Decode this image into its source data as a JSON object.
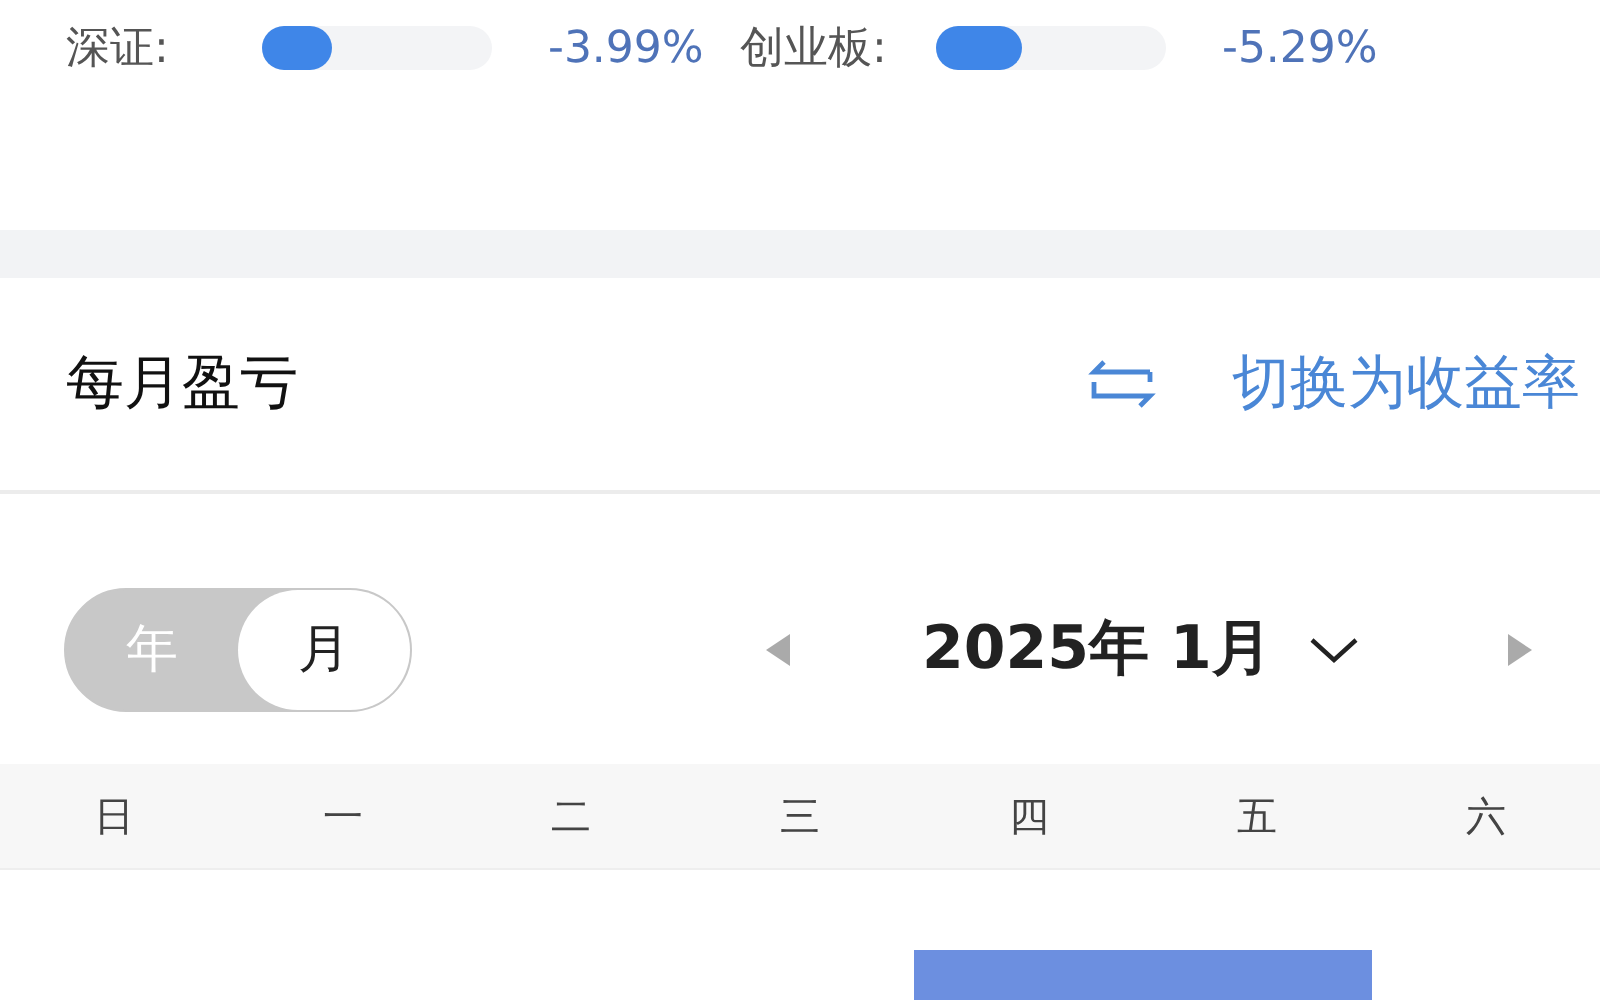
{
  "indices": [
    {
      "label": "深证:",
      "level": 0.3,
      "change": "-3.99%"
    },
    {
      "label": "创业板:",
      "level": 0.37,
      "change": "-5.29%"
    }
  ],
  "section": {
    "title": "每月盈亏",
    "switch_label": "切换为收益率"
  },
  "mode_toggle": [
    {
      "label": "年",
      "selected": false
    },
    {
      "label": "月",
      "selected": true
    }
  ],
  "month": "2025年 1月",
  "weekdays": [
    "日",
    "一",
    "二",
    "三",
    "四",
    "五",
    "六"
  ],
  "week_row": [
    {
      "highlighted": false
    },
    {
      "highlighted": false
    },
    {
      "highlighted": false
    },
    {
      "highlighted": false
    },
    {
      "highlighted": true
    },
    {
      "highlighted": true
    },
    {
      "highlighted": false
    }
  ]
}
